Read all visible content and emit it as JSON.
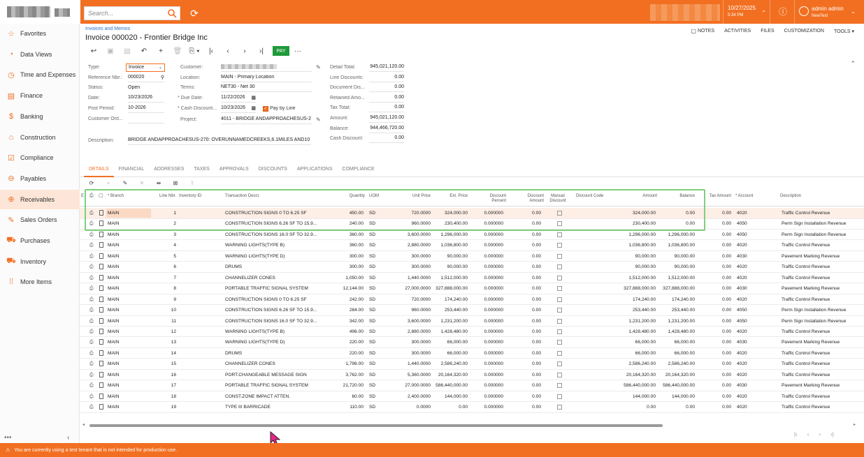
{
  "search": {
    "placeholder": "Search..."
  },
  "header": {
    "date": "10/27/2025",
    "time": "5:34 PM",
    "user_name": "admin admin",
    "user_tenant": "NewTest"
  },
  "sidebar": {
    "items": [
      {
        "label": "Favorites",
        "icon": "star-icon"
      },
      {
        "label": "Data Views",
        "icon": "chart-icon"
      },
      {
        "label": "Time and Expenses",
        "icon": "clock-icon"
      },
      {
        "label": "Finance",
        "icon": "ledger-icon"
      },
      {
        "label": "Banking",
        "icon": "dollar-icon"
      },
      {
        "label": "Construction",
        "icon": "crane-icon"
      },
      {
        "label": "Compliance",
        "icon": "checklist-icon"
      },
      {
        "label": "Payables",
        "icon": "minus-circle-icon"
      },
      {
        "label": "Receivables",
        "icon": "plus-circle-icon"
      },
      {
        "label": "Sales Orders",
        "icon": "edit-icon"
      },
      {
        "label": "Purchases",
        "icon": "cart-icon"
      },
      {
        "label": "Inventory",
        "icon": "truck-icon"
      },
      {
        "label": "More Items",
        "icon": "grid-icon"
      }
    ],
    "active_index": 8,
    "more": "•••"
  },
  "page": {
    "breadcrumb": "Invoices and Memos",
    "title": "Invoice 000020 - Frontier Bridge Inc",
    "links": [
      "NOTES",
      "ACTIVITIES",
      "FILES",
      "CUSTOMIZATION",
      "TOOLS ▾"
    ],
    "pay_label": "PAY"
  },
  "form": {
    "type_label": "Type:",
    "type_value": "Invoice",
    "ref_label": "Reference Nbr.:",
    "ref_value": "000020",
    "status_label": "Status:",
    "status_value": "Open",
    "date_label": "Date:",
    "date_value": "10/23/2026",
    "period_label": "Post Period:",
    "period_value": "10-2026",
    "custord_label": "Customer Ord...",
    "desc_label": "Description:",
    "desc_value": "BRIDGE ANDAPPROACHESUS-270: OVERUNNAMEDCREEKS,6.1MILES AND10",
    "customer_label": "Customer:",
    "location_label": "Location:",
    "location_value": "MAIN - Primary Location",
    "terms_label": "Terms:",
    "terms_value": "NET30 - Net 30",
    "due_label": "* Due Date:",
    "due_value": "11/22/2026",
    "cash_label": "* Cash Discount...",
    "cash_value": "10/23/2026",
    "paybyline_label": "Pay by Line",
    "project_label": "Project:",
    "project_value": "4011 - BRIDGE ANDAPPROACHESUS-2",
    "totals": [
      {
        "label": "Detail Total:",
        "value": "945,021,120.00"
      },
      {
        "label": "Line Discounts:",
        "value": "0.00"
      },
      {
        "label": "Document Dis...",
        "value": "0.00"
      },
      {
        "label": "Retained Amo...",
        "value": "0.00"
      },
      {
        "label": "Tax Total:",
        "value": "0.00"
      },
      {
        "label": "Amount:",
        "value": "945,021,120.00"
      },
      {
        "label": "Balance:",
        "value": "944,466,720.00"
      },
      {
        "label": "Cash Discount:",
        "value": "0.00"
      }
    ]
  },
  "tabs": [
    "DETAILS",
    "FINANCIAL",
    "ADDRESSES",
    "TAXES",
    "APPROVALS",
    "DISCOUNTS",
    "APPLICATIONS",
    "COMPLIANCE"
  ],
  "grid": {
    "headers": {
      "branch": "* Branch",
      "line": "Line Nbr.",
      "inventory": "Inventory ID",
      "descr": "Transaction Descr.",
      "qty": "Quantity",
      "uom": "UOM",
      "unit_price": "Unit Price",
      "ext_price": "Ext. Price",
      "disc_pct": "Discount Percent",
      "disc_amt": "Discount Amount",
      "manual": "Manual Discount",
      "disc_code": "Discount Code",
      "amount": "Amount",
      "balance": "Balance",
      "tax": "Tax Amount",
      "account": "* Account",
      "description": "Description",
      "stub": "E"
    },
    "rows": [
      {
        "branch": "MAIN",
        "line": "1",
        "descr": "CONSTRUCTION SIGNS 0 TO 6.25 SF",
        "qty": "450.00",
        "uom": "SD",
        "unit": "720.0000",
        "ext": "324,000.00",
        "pct": "0.000000",
        "damt": "0.00",
        "amount": "324,000.00",
        "balance": "0.00",
        "tax": "0.00",
        "account": "4020",
        "desc": "Traffic Control Revenue"
      },
      {
        "branch": "MAIN",
        "line": "2",
        "descr": "CONSTRUCTION SIGNS 6.26 SF TO 15.9...",
        "qty": "240.00",
        "uom": "SD",
        "unit": "960.0000",
        "ext": "230,400.00",
        "pct": "0.000000",
        "damt": "0.00",
        "amount": "230,400.00",
        "balance": "0.00",
        "tax": "0.00",
        "account": "4050",
        "desc": "Perm Sign Installation Revenue"
      },
      {
        "branch": "MAIN",
        "line": "3",
        "descr": "CONSTRUCTION SIGNS 16.0 SF TO 32.9...",
        "qty": "360.00",
        "uom": "SD",
        "unit": "3,600.0000",
        "ext": "1,296,000.00",
        "pct": "0.000000",
        "damt": "0.00",
        "amount": "1,296,000.00",
        "balance": "1,296,000.00",
        "tax": "0.00",
        "account": "4050",
        "desc": "Perm Sign Installation Revenue"
      },
      {
        "branch": "MAIN",
        "line": "4",
        "descr": "WARNING LIGHTS(TYPE B)",
        "qty": "360.00",
        "uom": "SD",
        "unit": "2,880.0000",
        "ext": "1,036,800.00",
        "pct": "0.000000",
        "damt": "0.00",
        "amount": "1,036,800.00",
        "balance": "1,036,800.00",
        "tax": "0.00",
        "account": "4020",
        "desc": "Traffic Control Revenue"
      },
      {
        "branch": "MAIN",
        "line": "5",
        "descr": "WARNING LIGHTS(TYPE D)",
        "qty": "300.00",
        "uom": "SD",
        "unit": "300.0000",
        "ext": "90,000.00",
        "pct": "0.000000",
        "damt": "0.00",
        "amount": "90,000.00",
        "balance": "90,000.00",
        "tax": "0.00",
        "account": "4030",
        "desc": "Pavement Marking Revenue"
      },
      {
        "branch": "MAIN",
        "line": "6",
        "descr": "DRUMS",
        "qty": "300.00",
        "uom": "SD",
        "unit": "300.0000",
        "ext": "90,000.00",
        "pct": "0.000000",
        "damt": "0.00",
        "amount": "90,000.00",
        "balance": "90,000.00",
        "tax": "0.00",
        "account": "4020",
        "desc": "Traffic Control Revenue"
      },
      {
        "branch": "MAIN",
        "line": "7",
        "descr": "CHANNELIZER CONES",
        "qty": "1,050.00",
        "uom": "SD",
        "unit": "1,440.0000",
        "ext": "1,512,000.00",
        "pct": "0.000000",
        "damt": "0.00",
        "amount": "1,512,000.00",
        "balance": "1,512,000.00",
        "tax": "0.00",
        "account": "4020",
        "desc": "Traffic Control Revenue"
      },
      {
        "branch": "MAIN",
        "line": "8",
        "descr": "PORTABLE TRAFFIC SIGNAL SYSTEM",
        "qty": "12,144.00",
        "uom": "SD",
        "unit": "27,000.0000",
        "ext": "327,888,000.00",
        "pct": "0.000000",
        "damt": "0.00",
        "amount": "327,888,000.00",
        "balance": "327,888,000.00",
        "tax": "0.00",
        "account": "4030",
        "desc": "Pavement Marking Revenue"
      },
      {
        "branch": "MAIN",
        "line": "9",
        "descr": "CONSTRUCTION SIGNS 0 TO 6.25 SF",
        "qty": "242.00",
        "uom": "SD",
        "unit": "720.0000",
        "ext": "174,240.00",
        "pct": "0.000000",
        "damt": "0.00",
        "amount": "174,240.00",
        "balance": "174,240.00",
        "tax": "0.00",
        "account": "4020",
        "desc": "Traffic Control Revenue"
      },
      {
        "branch": "MAIN",
        "line": "10",
        "descr": "CONSTRUCTION SIGNS 6.26 SF TO 15.9...",
        "qty": "264.00",
        "uom": "SD",
        "unit": "960.0000",
        "ext": "253,440.00",
        "pct": "0.000000",
        "damt": "0.00",
        "amount": "253,440.00",
        "balance": "253,440.00",
        "tax": "0.00",
        "account": "4050",
        "desc": "Perm Sign Installation Revenue"
      },
      {
        "branch": "MAIN",
        "line": "11",
        "descr": "CONSTRUCTION SIGNS 16.0 SF TO 32.9...",
        "qty": "342.00",
        "uom": "SD",
        "unit": "3,600.0000",
        "ext": "1,231,200.00",
        "pct": "0.000000",
        "damt": "0.00",
        "amount": "1,231,200.00",
        "balance": "1,231,200.00",
        "tax": "0.00",
        "account": "4050",
        "desc": "Perm Sign Installation Revenue"
      },
      {
        "branch": "MAIN",
        "line": "12",
        "descr": "WARNING LIGHTS(TYPE B)",
        "qty": "496.00",
        "uom": "SD",
        "unit": "2,880.0000",
        "ext": "1,428,480.00",
        "pct": "0.000000",
        "damt": "0.00",
        "amount": "1,428,480.00",
        "balance": "1,428,480.00",
        "tax": "0.00",
        "account": "4020",
        "desc": "Traffic Control Revenue"
      },
      {
        "branch": "MAIN",
        "line": "13",
        "descr": "WARNING LIGHTS(TYPE D)",
        "qty": "220.00",
        "uom": "SD",
        "unit": "300.0000",
        "ext": "66,000.00",
        "pct": "0.000000",
        "damt": "0.00",
        "amount": "66,000.00",
        "balance": "66,000.00",
        "tax": "0.00",
        "account": "4030",
        "desc": "Pavement Marking Revenue"
      },
      {
        "branch": "MAIN",
        "line": "14",
        "descr": "DRUMS",
        "qty": "220.00",
        "uom": "SD",
        "unit": "300.0000",
        "ext": "66,000.00",
        "pct": "0.000000",
        "damt": "0.00",
        "amount": "66,000.00",
        "balance": "66,000.00",
        "tax": "0.00",
        "account": "4020",
        "desc": "Traffic Control Revenue"
      },
      {
        "branch": "MAIN",
        "line": "15",
        "descr": "CHANNELIZER CONES",
        "qty": "1,796.00",
        "uom": "SD",
        "unit": "1,440.0000",
        "ext": "2,586,240.00",
        "pct": "0.000000",
        "damt": "0.00",
        "amount": "2,586,240.00",
        "balance": "2,586,240.00",
        "tax": "0.00",
        "account": "4020",
        "desc": "Traffic Control Revenue"
      },
      {
        "branch": "MAIN",
        "line": "16",
        "descr": "PORT.CHANGEABLE MESSAGE SIGN",
        "qty": "3,762.00",
        "uom": "SD",
        "unit": "5,360.0000",
        "ext": "20,164,320.00",
        "pct": "0.000000",
        "damt": "0.00",
        "amount": "20,164,320.00",
        "balance": "20,164,320.00",
        "tax": "0.00",
        "account": "4020",
        "desc": "Traffic Control Revenue"
      },
      {
        "branch": "MAIN",
        "line": "17",
        "descr": "PORTABLE TRAFFIC SIGNAL SYSTEM",
        "qty": "21,720.00",
        "uom": "SD",
        "unit": "27,000.0000",
        "ext": "586,440,000.00",
        "pct": "0.000000",
        "damt": "0.00",
        "amount": "586,440,000.00",
        "balance": "586,440,000.00",
        "tax": "0.00",
        "account": "4030",
        "desc": "Pavement Marking Revenue"
      },
      {
        "branch": "MAIN",
        "line": "18",
        "descr": "CONST.ZONE IMPACT ATTEN.",
        "qty": "60.00",
        "uom": "SD",
        "unit": "2,400.0000",
        "ext": "144,000.00",
        "pct": "0.000000",
        "damt": "0.00",
        "amount": "144,000.00",
        "balance": "144,000.00",
        "tax": "0.00",
        "account": "4020",
        "desc": "Traffic Control Revenue"
      },
      {
        "branch": "MAIN",
        "line": "19",
        "descr": "TYPE III BARRICADE",
        "qty": "110.00",
        "uom": "SD",
        "unit": "0.0000",
        "ext": "0.00",
        "pct": "0.000000",
        "damt": "0.00",
        "amount": "0.00",
        "balance": "0.00",
        "tax": "0.00",
        "account": "4020",
        "desc": "Traffic Control Revenue"
      }
    ]
  },
  "footer": {
    "message": "You are currently using a test tenant that is not intended for production use."
  },
  "colors": {
    "accent": "#f26f21",
    "pay": "#1f9a3a",
    "highlight": "#7dd07d"
  }
}
